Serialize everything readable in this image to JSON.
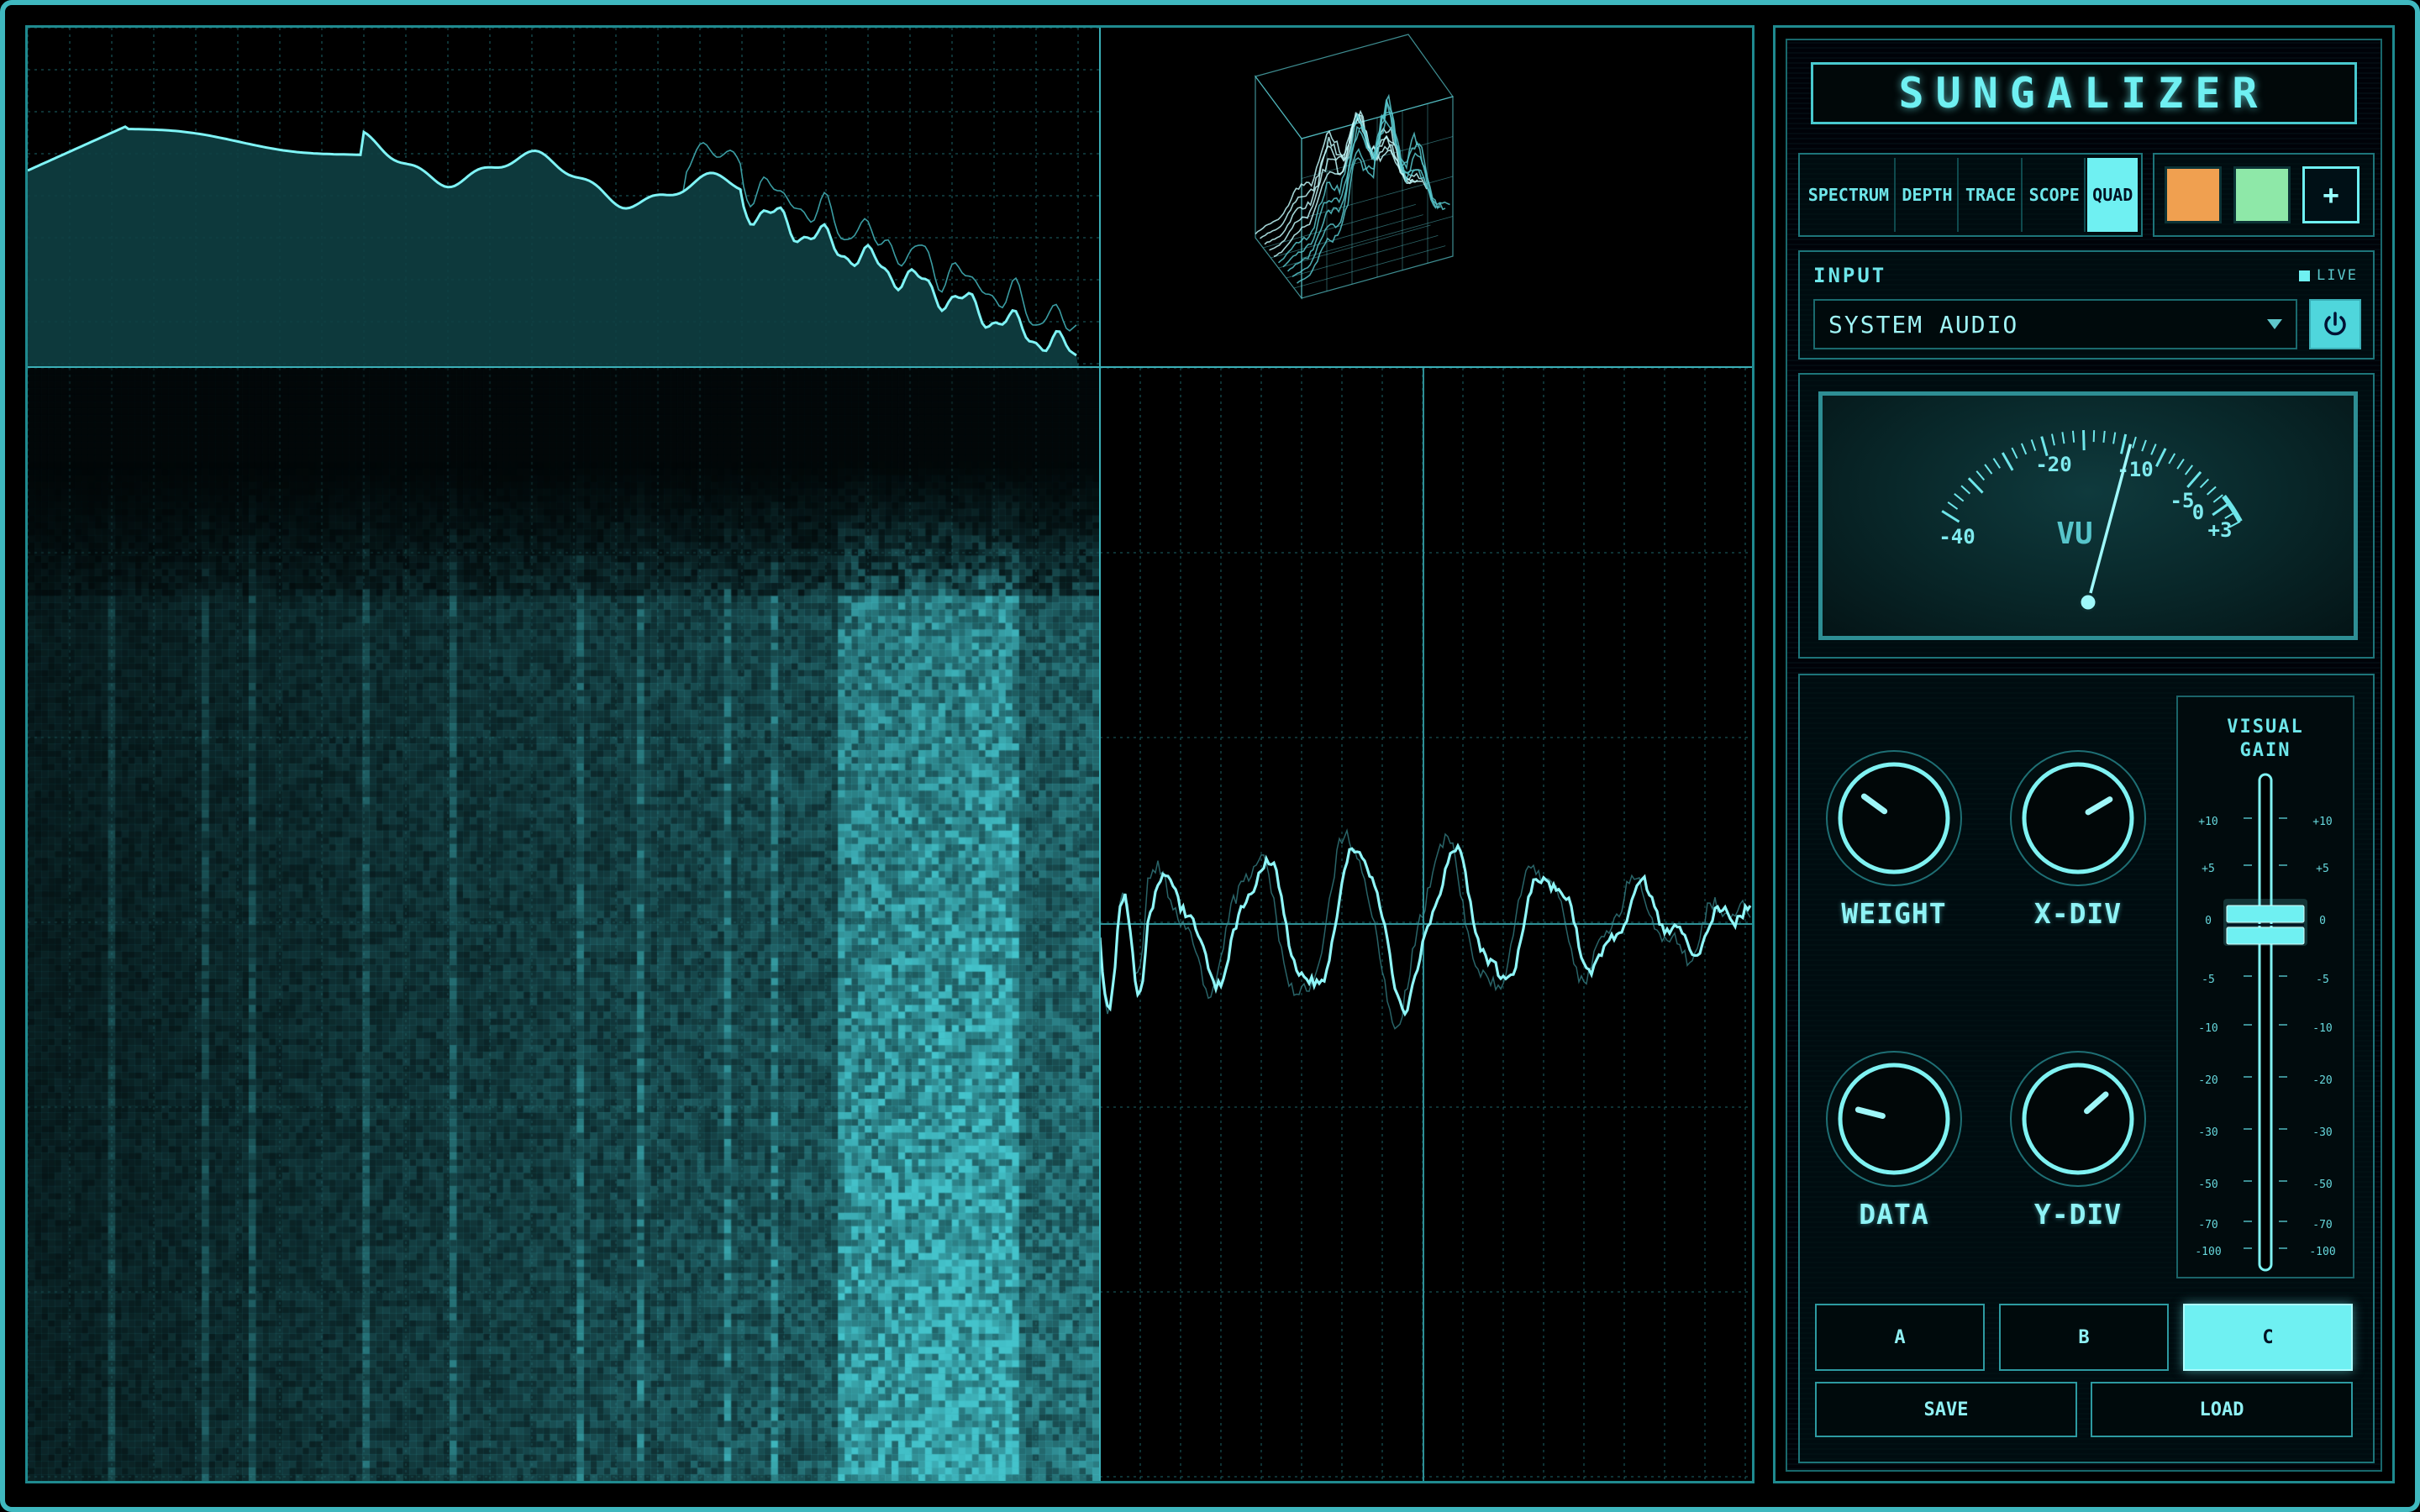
{
  "app": {
    "title": "SUNGALIZER"
  },
  "tabs": [
    {
      "label": "SPECTRUM",
      "active": false
    },
    {
      "label": "DEPTH",
      "active": false
    },
    {
      "label": "TRACE",
      "active": false
    },
    {
      "label": "SCOPE",
      "active": false
    },
    {
      "label": "QUAD",
      "active": true
    }
  ],
  "colors": {
    "accent": "#6ff0f2",
    "swatch_orange": "#f0a050",
    "swatch_green": "#8ee8a8",
    "panel_border": "#3fb8bf"
  },
  "swatches": {
    "add_label": "+"
  },
  "input": {
    "label": "INPUT",
    "live_label": "LIVE",
    "source": "SYSTEM AUDIO",
    "power_icon": "power-icon"
  },
  "vu_meter": {
    "label": "VU",
    "scale": [
      "-40",
      "-20",
      "-10",
      "-5",
      "0",
      "+3"
    ],
    "needle_db": -10
  },
  "knobs": [
    {
      "label": "WEIGHT",
      "value": 0.3
    },
    {
      "label": "X-DIV",
      "value": 0.72
    },
    {
      "label": "DATA",
      "value": 0.22
    },
    {
      "label": "Y-DIV",
      "value": 0.68
    }
  ],
  "fader": {
    "title_line1": "VISUAL",
    "title_line2": "GAIN",
    "scale": [
      "+10",
      "+5",
      "0",
      "-5",
      "-10",
      "-20",
      "-30",
      "-50",
      "-70",
      "-100"
    ],
    "value_db": 0
  },
  "presets": [
    {
      "label": "A",
      "active": false
    },
    {
      "label": "B",
      "active": false
    },
    {
      "label": "C",
      "active": true
    }
  ],
  "actions": {
    "save": "SAVE",
    "load": "LOAD"
  }
}
